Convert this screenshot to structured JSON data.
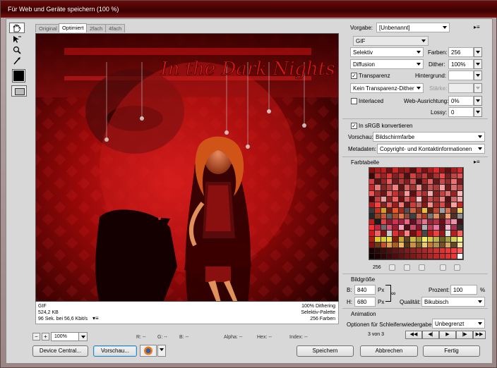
{
  "window": {
    "title": "Für Web und Geräte speichern (100 %)"
  },
  "tabs": [
    "Original",
    "Optimiert",
    "2fach",
    "4fach"
  ],
  "artwork": {
    "text": "In the Dark Nights"
  },
  "info_left": [
    "GIF",
    "524,2 KB",
    "96 Sek. bei 56,6 Kbit/s"
  ],
  "info_right": [
    "100% Dithering",
    "Selektiv-Palette",
    "256 Farben"
  ],
  "status": {
    "minus": "−",
    "plus": "+",
    "zoom": "100%",
    "r": "R: --",
    "g": "G: --",
    "b": "B: --",
    "alpha": "Alpha: --",
    "hex": "Hex: --",
    "index": "Index: --"
  },
  "buttons": {
    "device_central": "Device Central...",
    "preview": "Vorschau...",
    "save": "Speichern",
    "cancel": "Abbrechen",
    "done": "Fertig"
  },
  "settings": {
    "preset_label": "Vorgabe:",
    "preset_value": "[Unbenannt]",
    "format": "GIF",
    "reduction": "Selektiv",
    "colors_label": "Farben:",
    "colors_value": "256",
    "dither_algo": "Diffusion",
    "dither_label": "Dither:",
    "dither_value": "100%",
    "transparency_label": "Transparenz",
    "matte_label": "Hintergrund:",
    "transparency_dither": "Kein Transparenz-Dither",
    "amount_label": "Stärke:",
    "interlaced_label": "Interlaced",
    "websnap_label": "Web-Ausrichtung:",
    "websnap_value": "0%",
    "lossy_label": "Lossy:",
    "lossy_value": "0",
    "srgb_label": "In sRGB konvertieren",
    "preview_label": "Vorschau:",
    "preview_value": "Bildschirmfarbe",
    "metadata_label": "Metadaten:",
    "metadata_value": "Copyright- und Kontaktinformationen"
  },
  "color_table": {
    "title": "Farbtabelle",
    "count": "256",
    "colors": [
      "#8a1010",
      "#b01818",
      "#c41c1c",
      "#701010",
      "#d02020",
      "#901414",
      "#a41818",
      "#5c0c0c",
      "#c82424",
      "#7a1212",
      "#b41a1a",
      "#e02828",
      "#981616",
      "#641010",
      "#ac1c1c",
      "#d82a2a",
      "#3c0808",
      "#c03030",
      "#a02020",
      "#e43434",
      "#802020",
      "#b82c2c",
      "#501010",
      "#d44040",
      "#902828",
      "#c83838",
      "#6c1818",
      "#a83030",
      "#f04848",
      "#782020",
      "#c04444",
      "#e05050",
      "#d83c3c",
      "#581414",
      "#9c2424",
      "#ec5c5c",
      "#701c1c",
      "#b43838",
      "#881c1c",
      "#d05050",
      "#400c0c",
      "#a82828",
      "#e86060",
      "#601818",
      "#cc4848",
      "#942c2c",
      "#f07070",
      "#7c1c1c",
      "#c02828",
      "#e87878",
      "#802828",
      "#b04040",
      "#f08080",
      "#5c1818",
      "#d46060",
      "#9c3434",
      "#e89090",
      "#682020",
      "#c05050",
      "#a83c3c",
      "#f4a0a0",
      "#741c1c",
      "#d87070",
      "#b84848",
      "#f05050",
      "#a02828",
      "#701414",
      "#e86868",
      "#c83030",
      "#8c2424",
      "#f89898",
      "#601010",
      "#d84848",
      "#b03030",
      "#f0b0b0",
      "#842020",
      "#c84040",
      "#e07070",
      "#9c2020",
      "#ffb8b8",
      "#4c0808",
      "#c83c3c",
      "#e8a0a0",
      "#902020",
      "#f06060",
      "#6c1010",
      "#d85c5c",
      "#b42828",
      "#f8c8c8",
      "#7c1818",
      "#c84c4c",
      "#a83434",
      "#e88080",
      "#581010",
      "#d06868",
      "#f0a8a8",
      "#b81c1c",
      "#ff4040",
      "#802424",
      "#e85858",
      "#981c1c",
      "#f07878",
      "#641414",
      "#d03c3c",
      "#c06060",
      "#881818",
      "#f89090",
      "#a02c2c",
      "#e04848",
      "#701818",
      "#ffa0a0",
      "#c82828",
      "#3a3a3a",
      "#c8301c",
      "#d4a020",
      "#701c10",
      "#e85828",
      "#a82818",
      "#505050",
      "#d06040",
      "#8c3018",
      "#e8c040",
      "#602010",
      "#c04830",
      "#a0a0a0",
      "#d87050",
      "#783020",
      "#f0d060",
      "#282828",
      "#884020",
      "#c85838",
      "#606060",
      "#a85028",
      "#e07848",
      "#904838",
      "#404040",
      "#c86850",
      "#b03c20",
      "#787878",
      "#d89060",
      "#683018",
      "#f0a070",
      "#503020",
      "#909090",
      "#c01c1c",
      "#1a1a1a",
      "#e84040",
      "#8c1c30",
      "#d03050",
      "#a82040",
      "#f06080",
      "#601020",
      "#c04060",
      "#e87090",
      "#902838",
      "#b83048",
      "#700c18",
      "#d85878",
      "#f090a8",
      "#481018",
      "#ff3030",
      "#c82040",
      "#6c6c6c",
      "#e05070",
      "#a01c30",
      "#f8a0b8",
      "#501018",
      "#d04868",
      "#881830",
      "#b0b0b0",
      "#c83858",
      "#e878a0",
      "#681020",
      "#f0b8c8",
      "#a83050",
      "#303030",
      "#d81818",
      "#f86060",
      "#8c1414",
      "#c8c8c8",
      "#e03030",
      "#a81c1c",
      "#ff8080",
      "#741010",
      "#d82020",
      "#484848",
      "#c01818",
      "#f04040",
      "#981818",
      "#e0e0e0",
      "#b81c1c",
      "#fe6060",
      "#b02010",
      "#e8c820",
      "#d8d030",
      "#f0e040",
      "#802010",
      "#c8a828",
      "#604020",
      "#d0b838",
      "#a09030",
      "#f8f060",
      "#e0c840",
      "#c0b050",
      "#706020",
      "#a8a040",
      "#d8d050",
      "#fcfc80",
      "#901010",
      "#6c3818",
      "#c85028",
      "#e0a050",
      "#a86020",
      "#f0b860",
      "#503818",
      "#d09040",
      "#806028",
      "#e8c878",
      "#c87830",
      "#b09050",
      "#785028",
      "#d8a860",
      "#604828",
      "#f8e0a0",
      "#1c0404",
      "#2c0808",
      "#3c0c0c",
      "#4c1010",
      "#5c1414",
      "#6c1818",
      "#7c1c1c",
      "#8c2020",
      "#9c2424",
      "#ac2828",
      "#bc2c2c",
      "#cc3030",
      "#dc3434",
      "#ec3838",
      "#fc3c3c",
      "#ff6060",
      "#100000",
      "#200000",
      "#300404",
      "#400808",
      "#500c0c",
      "#601010",
      "#701414",
      "#801818",
      "#901c1c",
      "#a02020",
      "#b02424",
      "#c02828",
      "#d02c2c",
      "#e03030",
      "#f03434",
      "#ffffff"
    ]
  },
  "image_size": {
    "title": "Bildgröße",
    "w_label": "B:",
    "w_value": "840",
    "w_unit": "Px",
    "h_label": "H:",
    "h_value": "680",
    "h_unit": "Px",
    "percent_label": "Prozent:",
    "percent_value": "100",
    "percent_unit": "%",
    "quality_label": "Qualität:",
    "quality_value": "Bikubisch"
  },
  "animation": {
    "title": "Animation",
    "loop_label": "Optionen für Schleifenwiedergabe:",
    "loop_value": "Unbegrenzt",
    "frame_counter": "3 von 3",
    "nav": [
      "◀◀",
      "◀|",
      "▶",
      "|▶",
      "▶▶"
    ]
  }
}
